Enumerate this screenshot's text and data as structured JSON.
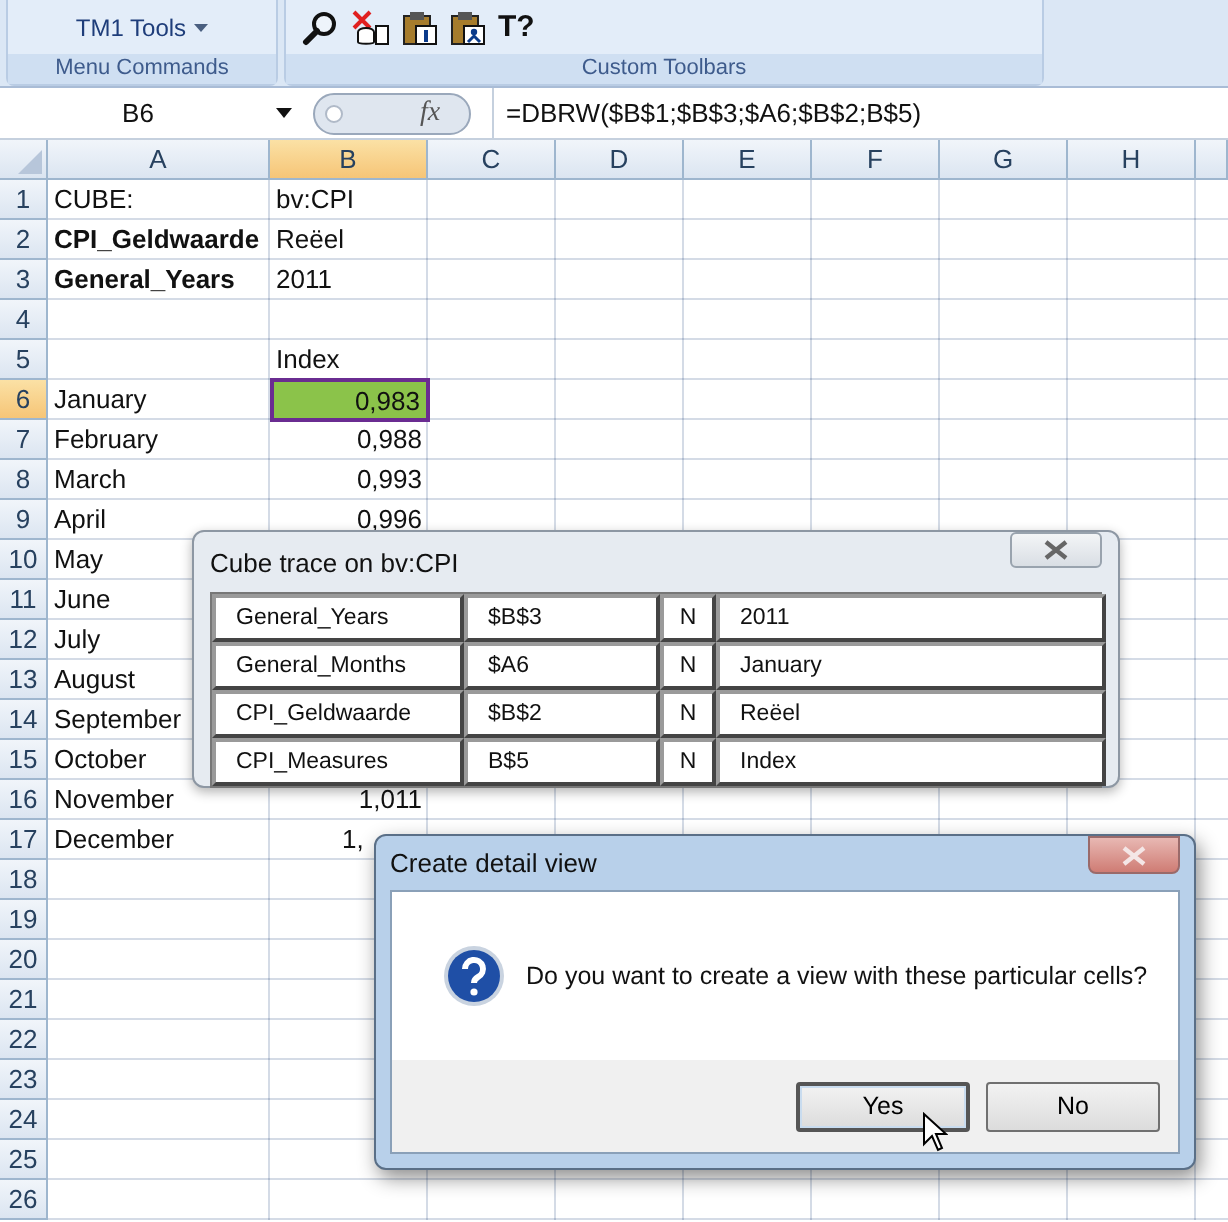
{
  "ribbon": {
    "groups": [
      {
        "kind": "menu",
        "label": "Menu Commands",
        "button": {
          "label": "TM1 Tools"
        }
      },
      {
        "kind": "toolbar",
        "label": "Custom Toolbars",
        "tools": [
          {
            "kind": "search"
          },
          {
            "kind": "delete"
          },
          {
            "kind": "paste-number"
          },
          {
            "kind": "paste-person"
          },
          {
            "kind": "text",
            "label": "T?"
          }
        ]
      }
    ]
  },
  "formula_bar": {
    "name_box": "B6",
    "function_button": "fx",
    "formula": "=DBRW($B$1;$B$3;$A6;$B$2;B$5)"
  },
  "columns": [
    {
      "label": "A",
      "selected": false
    },
    {
      "label": "B",
      "selected": true
    },
    {
      "label": "C",
      "selected": false
    },
    {
      "label": "D",
      "selected": false
    },
    {
      "label": "E",
      "selected": false
    },
    {
      "label": "F",
      "selected": false
    },
    {
      "label": "G",
      "selected": false
    },
    {
      "label": "H",
      "selected": false
    }
  ],
  "rows": [
    {
      "number": "1",
      "selected": false,
      "label": "CUBE:",
      "label_bold": false,
      "value": "bv:CPI",
      "kind": "text"
    },
    {
      "number": "2",
      "selected": false,
      "label": "CPI_Geldwaarde",
      "label_bold": true,
      "value": "Reëel",
      "kind": "text"
    },
    {
      "number": "3",
      "selected": false,
      "label": "General_Years",
      "label_bold": true,
      "value": "2011",
      "kind": "text"
    },
    {
      "number": "4",
      "selected": false
    },
    {
      "number": "5",
      "selected": false,
      "value": "Index",
      "kind": "text"
    },
    {
      "number": "6",
      "selected": true,
      "label": "January",
      "label_bold": false,
      "value": "0,983",
      "kind": "number"
    },
    {
      "number": "7",
      "selected": false,
      "label": "February",
      "label_bold": false,
      "value": "0,988",
      "kind": "number"
    },
    {
      "number": "8",
      "selected": false,
      "label": "March",
      "label_bold": false,
      "value": "0,993",
      "kind": "number"
    },
    {
      "number": "9",
      "selected": false,
      "label": "April",
      "label_bold": false,
      "value": "0,996",
      "kind": "number"
    },
    {
      "number": "10",
      "selected": false,
      "label": "May",
      "label_bold": false
    },
    {
      "number": "11",
      "selected": false,
      "label": "June",
      "label_bold": false
    },
    {
      "number": "12",
      "selected": false,
      "label": "July",
      "label_bold": false
    },
    {
      "number": "13",
      "selected": false,
      "label": "August",
      "label_bold": false
    },
    {
      "number": "14",
      "selected": false,
      "label": "September",
      "label_bold": false
    },
    {
      "number": "15",
      "selected": false,
      "label": "October",
      "label_bold": false
    },
    {
      "number": "16",
      "selected": false,
      "label": "November",
      "label_bold": false,
      "value": "1,011",
      "kind": "number"
    },
    {
      "number": "17",
      "selected": false,
      "label": "December",
      "label_bold": false,
      "value": "1,",
      "kind": "partial"
    },
    {
      "number": "18",
      "selected": false
    },
    {
      "number": "19",
      "selected": false
    },
    {
      "number": "20",
      "selected": false
    },
    {
      "number": "21",
      "selected": false
    },
    {
      "number": "22",
      "selected": false
    },
    {
      "number": "23",
      "selected": false
    },
    {
      "number": "24",
      "selected": false
    },
    {
      "number": "25",
      "selected": false
    },
    {
      "number": "26",
      "selected": false
    }
  ],
  "trace_dialog": {
    "title": "Cube trace on bv:CPI",
    "rows": [
      {
        "dimension": "General_Years",
        "reference": "$B$3",
        "flag": "N",
        "element": "2011"
      },
      {
        "dimension": "General_Months",
        "reference": "$A6",
        "flag": "N",
        "element": "January"
      },
      {
        "dimension": "CPI_Geldwaarde",
        "reference": "$B$2",
        "flag": "N",
        "element": "Reëel"
      },
      {
        "dimension": "CPI_Measures",
        "reference": "B$5",
        "flag": "N",
        "element": "Index"
      }
    ]
  },
  "detail_dialog": {
    "title": "Create detail view",
    "message": "Do you want to create a view with these particular cells?",
    "buttons": [
      {
        "label": "Yes",
        "selected": true
      },
      {
        "label": "No",
        "selected": false
      }
    ]
  }
}
